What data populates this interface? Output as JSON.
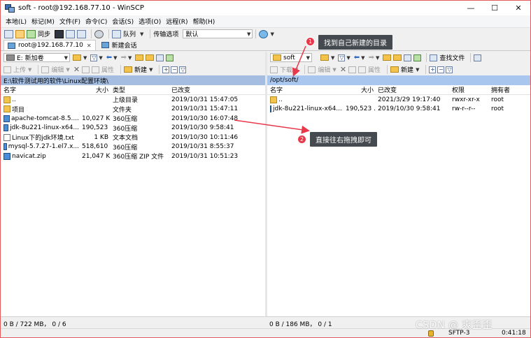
{
  "window": {
    "title": "soft - root@192.168.77.10 - WinSCP",
    "minimize": "—",
    "maximize": "☐",
    "close": "✕"
  },
  "menu": [
    "本地(L)",
    "标记(M)",
    "文件(F)",
    "命令(C)",
    "会话(S)",
    "选项(O)",
    "远程(R)",
    "帮助(H)"
  ],
  "toolbar": {
    "sync_label": "同步",
    "queue_label": "队列",
    "transfer_label": "传输选项",
    "transfer_value": "默认"
  },
  "tabs": {
    "session": "root@192.168.77.10",
    "new_session": "新建会话"
  },
  "left": {
    "drive": "E: 新加卷",
    "upload": "上传",
    "edit": "编辑",
    "properties": "属性",
    "new": "新建",
    "path": "E:\\软件测试用的软件\\Linux配置环境\\",
    "headers": {
      "name": "名字",
      "size": "大小",
      "type": "类型",
      "modified": "已改变"
    },
    "files": [
      {
        "name": "..",
        "size": "",
        "type": "上级目录",
        "modified": "2019/10/31  15:47:05",
        "icon": "up"
      },
      {
        "name": "项目",
        "size": "",
        "type": "文件夹",
        "modified": "2019/10/31  15:47:11",
        "icon": "folder"
      },
      {
        "name": "apache-tomcat-8.5....",
        "size": "10,027 KB",
        "type": "360压缩",
        "modified": "2019/10/30  16:07:48",
        "icon": "zip"
      },
      {
        "name": "jdk-8u221-linux-x64...",
        "size": "190,523 ...",
        "type": "360压缩",
        "modified": "2019/10/30  9:58:41",
        "icon": "zip"
      },
      {
        "name": "Linux下的jdk环境.txt",
        "size": "1 KB",
        "type": "文本文档",
        "modified": "2019/10/30  10:11:46",
        "icon": "txt"
      },
      {
        "name": "mysql-5.7.27-1.el7.x...",
        "size": "518,610 ...",
        "type": "360压缩",
        "modified": "2019/10/31  8:55:37",
        "icon": "zip"
      },
      {
        "name": "navicat.zip",
        "size": "21,047 KB",
        "type": "360压缩 ZIP 文件",
        "modified": "2019/10/31  10:51:23",
        "icon": "zip"
      }
    ],
    "status": "0 B / 722 MB，  0 / 6"
  },
  "right": {
    "folder": "soft",
    "download": "下载",
    "edit": "编辑",
    "properties": "属性",
    "new": "新建",
    "find": "查找文件",
    "path": "/opt/soft/",
    "headers": {
      "name": "名字",
      "size": "大小",
      "modified": "已改变",
      "rights": "权限",
      "owner": "拥有者"
    },
    "files": [
      {
        "name": "..",
        "size": "",
        "modified": "2021/3/29 19:17:40",
        "rights": "rwxr-xr-x",
        "owner": "root",
        "icon": "up"
      },
      {
        "name": "jdk-8u221-linux-x64....",
        "size": "190,523 ...",
        "modified": "2019/10/30 9:58:41",
        "rights": "rw-r--r--",
        "owner": "root",
        "icon": "zip"
      }
    ],
    "status": "0 B / 186 MB，  0 / 1"
  },
  "statusbar": {
    "protocol": "SFTP-3",
    "time": "0:41:18"
  },
  "annotations": {
    "badge1": "1",
    "callout1": "找到自己新建的目录",
    "badge2": "2",
    "callout2": "直接往右拖拽即可",
    "color": "#e8384a"
  },
  "watermark": "CSDN @ 爽歪歪"
}
